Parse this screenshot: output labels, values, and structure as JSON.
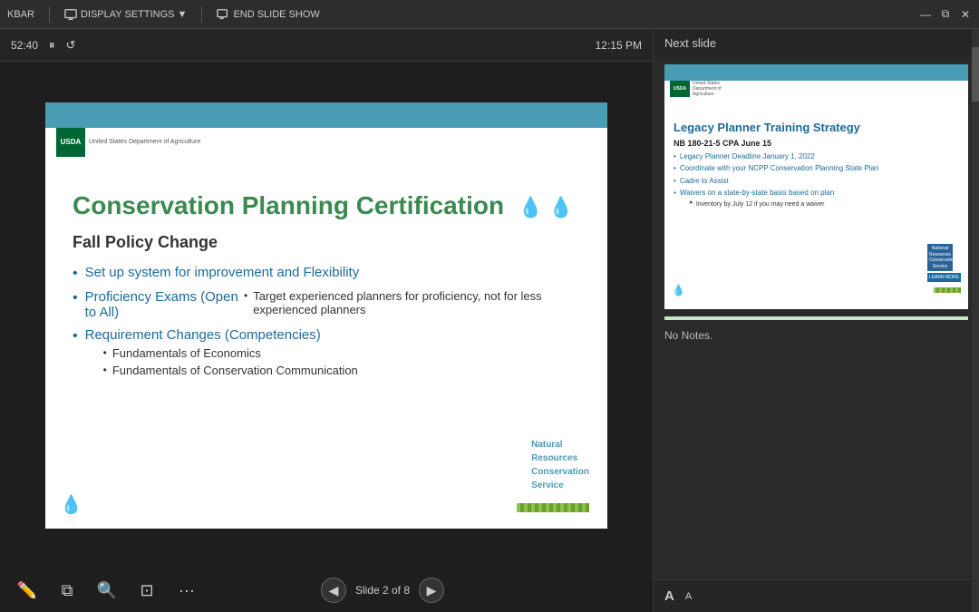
{
  "toolbar": {
    "taskbar_label": "KBAR",
    "display_settings_label": "DISPLAY SETTINGS ▼",
    "end_slideshow_label": "END SLIDE SHOW"
  },
  "playback": {
    "time_elapsed": "52:40",
    "time_current": "12:15 PM"
  },
  "slide": {
    "title": "Conservation Planning Certification",
    "subtitle": "Fall Policy Change",
    "bullets": [
      "Set up system for improvement and Flexibility",
      "Proficiency Exams (Open to All)",
      "Requirement Changes (Competencies)"
    ],
    "sub_bullets_proficiency": [
      "Target experienced planners for proficiency, not for less experienced planners"
    ],
    "sub_bullets_requirement": [
      "Fundamentals of Economics",
      "Fundamentals of Conservation Communication"
    ],
    "nrcs_text": "Natural\nResources\nConservation\nService",
    "usda_label": "USDA",
    "usda_sub": "United States Department of Agriculture"
  },
  "right_panel": {
    "next_slide_label": "Next slide",
    "preview": {
      "title": "Legacy Planner Training Strategy",
      "subtitle": "NB 180-21-5 CPA June 15",
      "bullets": [
        "Legacy Planner Deadline January 1, 2022",
        "Coordinate with your NCPP Conservation Planning State Plan",
        "Cadre to Assist",
        "Waivers on a state-by-state basis based on plan"
      ],
      "sub_bullets": [
        "Inventory by July 12 if you may need a waiver"
      ]
    },
    "notes_label": "No Notes."
  },
  "navigation": {
    "slide_current": "2",
    "slide_total": "8",
    "slide_label": "Slide 2 of 8"
  },
  "text_tools": {
    "increase_font": "A",
    "decrease_font": "A"
  }
}
